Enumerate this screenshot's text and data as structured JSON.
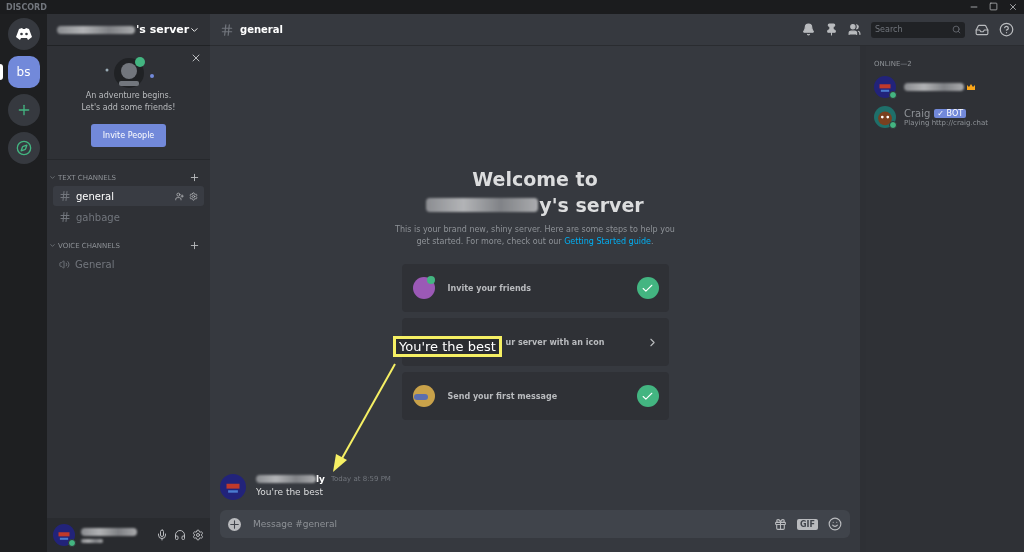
{
  "window": {
    "title": "DISCORD"
  },
  "guilds": [
    {
      "kind": "home",
      "selected": false
    },
    {
      "kind": "server",
      "label": "bs",
      "selected": true
    },
    {
      "kind": "add",
      "selected": false
    },
    {
      "kind": "explore",
      "selected": false
    }
  ],
  "server": {
    "name_suffix": "'s server"
  },
  "invite_card": {
    "lines": [
      "An adventure begins.",
      "Let's add some friends!"
    ],
    "button": "Invite People"
  },
  "categories": [
    {
      "name": "TEXT CHANNELS",
      "expanded": true,
      "channels": [
        {
          "kind": "text",
          "name": "general",
          "selected": true
        },
        {
          "kind": "text",
          "name": "gahbage",
          "selected": false
        }
      ]
    },
    {
      "name": "VOICE CHANNELS",
      "expanded": true,
      "channels": [
        {
          "kind": "voice",
          "name": "General",
          "selected": false
        }
      ]
    }
  ],
  "header": {
    "channel": "general",
    "search_placeholder": "Search"
  },
  "welcome": {
    "title": "Welcome to",
    "server_suffix": "y's server",
    "description": "This is your brand new, shiny server. Here are some steps to help you get started. For more, check out our ",
    "link": "Getting Started guide",
    "after_link": "."
  },
  "steps": [
    {
      "kind": "invite",
      "text": "Invite your friends",
      "done": true
    },
    {
      "kind": "icon",
      "text": "ur server with an icon",
      "done": false
    },
    {
      "kind": "message",
      "text": "Send your first message",
      "done": true
    }
  ],
  "message": {
    "author_suffix": "ly",
    "timestamp": "Today at 8:59 PM",
    "text": "You're the best"
  },
  "composer": {
    "placeholder": "Message #general",
    "gif_label": "GIF"
  },
  "members": {
    "heading": "ONLINE—2",
    "list": [
      {
        "kind": "owner"
      },
      {
        "kind": "bot",
        "name": "Craig",
        "badge": "✓ BOT",
        "activity": "Playing http://craig.chat"
      }
    ]
  },
  "annotation": {
    "text": "You're the best"
  }
}
